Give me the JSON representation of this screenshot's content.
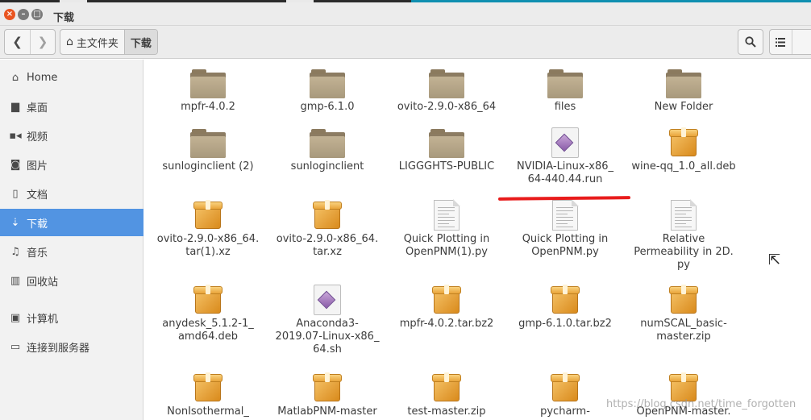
{
  "window": {
    "title": "下载"
  },
  "toolbar": {
    "back_icon": "chevron-left-icon",
    "forward_icon": "chevron-right-icon",
    "breadcrumbs": [
      "主文件夹",
      "下载"
    ],
    "search_icon": "search-icon",
    "list_view_icon": "list-view-icon"
  },
  "sidebar": {
    "items": [
      {
        "label": "Home",
        "icon": "home-icon"
      },
      {
        "label": "桌面",
        "icon": "desktop-folder-icon"
      },
      {
        "label": "视频",
        "icon": "video-icon"
      },
      {
        "label": "图片",
        "icon": "camera-icon"
      },
      {
        "label": "文档",
        "icon": "document-icon"
      },
      {
        "label": "下载",
        "icon": "download-icon",
        "active": true
      },
      {
        "label": "音乐",
        "icon": "music-icon"
      },
      {
        "label": "回收站",
        "icon": "trash-icon"
      },
      {
        "label": "计算机",
        "icon": "computer-icon"
      },
      {
        "label": "连接到服务器",
        "icon": "server-icon"
      }
    ]
  },
  "files": [
    {
      "name": "mpfr-4.0.2",
      "type": "folder"
    },
    {
      "name": "gmp-6.1.0",
      "type": "folder"
    },
    {
      "name": "ovito-2.9.0-x86_64",
      "type": "folder"
    },
    {
      "name": "files",
      "type": "folder"
    },
    {
      "name": "New Folder",
      "type": "folder"
    },
    {
      "name": "sunloginclient (2)",
      "type": "folder"
    },
    {
      "name": "sunloginclient",
      "type": "folder"
    },
    {
      "name": "LIGGGHTS-PUBLIC",
      "type": "folder"
    },
    {
      "name": "NVIDIA-Linux-x86_64-440.44.run",
      "type": "script"
    },
    {
      "name": "wine-qq_1.0_all.deb",
      "type": "package"
    },
    {
      "name": "ovito-2.9.0-x86_64.tar(1).xz",
      "type": "package"
    },
    {
      "name": "ovito-2.9.0-x86_64.tar.xz",
      "type": "package"
    },
    {
      "name": "Quick Plotting in OpenPNM(1).py",
      "type": "text"
    },
    {
      "name": "Quick Plotting in OpenPNM.py",
      "type": "text"
    },
    {
      "name": "Relative Permeability in 2D.py",
      "type": "text"
    },
    {
      "name": "anydesk_5.1.2-1_amd64.deb",
      "type": "package"
    },
    {
      "name": "Anaconda3-2019.07-Linux-x86_64.sh",
      "type": "script"
    },
    {
      "name": "mpfr-4.0.2.tar.bz2",
      "type": "package"
    },
    {
      "name": "gmp-6.1.0.tar.bz2",
      "type": "package"
    },
    {
      "name": "numSCAL_basic-master.zip",
      "type": "package"
    },
    {
      "name": "NonIsothermal_",
      "type": "package"
    },
    {
      "name": "MatlabPNM-master",
      "type": "package"
    },
    {
      "name": "test-master.zip",
      "type": "package"
    },
    {
      "name": "pycharm-",
      "type": "package"
    },
    {
      "name": "OpenPNM-master.",
      "type": "package"
    }
  ],
  "file_labels": [
    [
      "mpfr-4.0.2"
    ],
    [
      "gmp-6.1.0"
    ],
    [
      "ovito-2.9.0-x86_64"
    ],
    [
      "files"
    ],
    [
      "New Folder"
    ],
    [
      "sunloginclient (2)"
    ],
    [
      "sunloginclient"
    ],
    [
      "LIGGGHTS-PUBLIC"
    ],
    [
      "NVIDIA-Linux-x86_",
      "64-440.44.run"
    ],
    [
      "wine-qq_1.0_all.deb"
    ],
    [
      "ovito-2.9.0-x86_64.",
      "tar(1).xz"
    ],
    [
      "ovito-2.9.0-x86_64.",
      "tar.xz"
    ],
    [
      "Quick Plotting in",
      "OpenPNM(1).py"
    ],
    [
      "Quick Plotting in",
      "OpenPNM.py"
    ],
    [
      "Relative",
      "Permeability in 2D.",
      "py"
    ],
    [
      "anydesk_5.1.2-1_",
      "amd64.deb"
    ],
    [
      "Anaconda3-",
      "2019.07-Linux-x86_",
      "64.sh"
    ],
    [
      "mpfr-4.0.2.tar.bz2"
    ],
    [
      "gmp-6.1.0.tar.bz2"
    ],
    [
      "numSCAL_basic-",
      "master.zip"
    ],
    [
      "NonIsothermal_"
    ],
    [
      "MatlabPNM-master"
    ],
    [
      "test-master.zip"
    ],
    [
      "pycharm-"
    ],
    [
      "OpenPNM-master."
    ]
  ],
  "watermark": "https://blog.csdn.net/time_forgotten",
  "colors": {
    "sidebar_active": "#5294e2",
    "close_button": "#e95420",
    "annotation_underline": "#e81c1c"
  }
}
